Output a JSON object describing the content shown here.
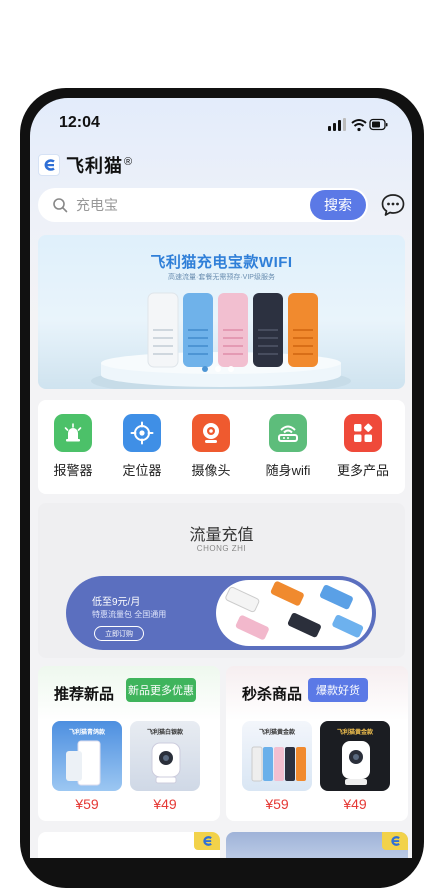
{
  "status_bar": {
    "time": "12:04"
  },
  "header": {
    "brand": "飞利猫",
    "reg_mark": "®"
  },
  "search": {
    "placeholder": "充电宝",
    "button": "搜索"
  },
  "banner": {
    "title": "飞利猫充电宝款WIFI",
    "subtitle": "高速流量·套餐无需预存·VIP级服务"
  },
  "categories": [
    {
      "label": "报警器",
      "icon": "alarm-icon",
      "color": "#4cc169"
    },
    {
      "label": "定位器",
      "icon": "locator-icon",
      "color": "#3f8fe6"
    },
    {
      "label": "摄像头",
      "icon": "camera-icon",
      "color": "#ef5a2f"
    },
    {
      "label": "随身wifi",
      "icon": "router-icon",
      "color": "#5dbd7b"
    },
    {
      "label": "更多产品",
      "icon": "grid-icon",
      "color": "#ef4a3a"
    }
  ],
  "recharge": {
    "title": "流量充值",
    "subtitle": "CHONG ZHI",
    "promo_line1": "低至9元/月",
    "promo_line2": "特惠流量包 全国通用",
    "promo_button": "立即订购"
  },
  "new_products": {
    "title": "推荐新品",
    "tag": "新品更多优惠",
    "tag_color": "#3fb45c",
    "items": [
      {
        "name": "飞利猫青鸽款",
        "price": "¥59"
      },
      {
        "name": "飞利猫白银款",
        "price": "¥49"
      }
    ]
  },
  "flash_sale": {
    "title": "秒杀商品",
    "tag": "爆款好货",
    "tag_color": "#5b79e6",
    "items": [
      {
        "name": "飞利猫黄金款",
        "price": "¥59"
      },
      {
        "name": "飞利猫黄金款",
        "price": "¥49"
      }
    ]
  },
  "colors": {
    "accent": "#5b79e6",
    "price": "#e53935"
  }
}
